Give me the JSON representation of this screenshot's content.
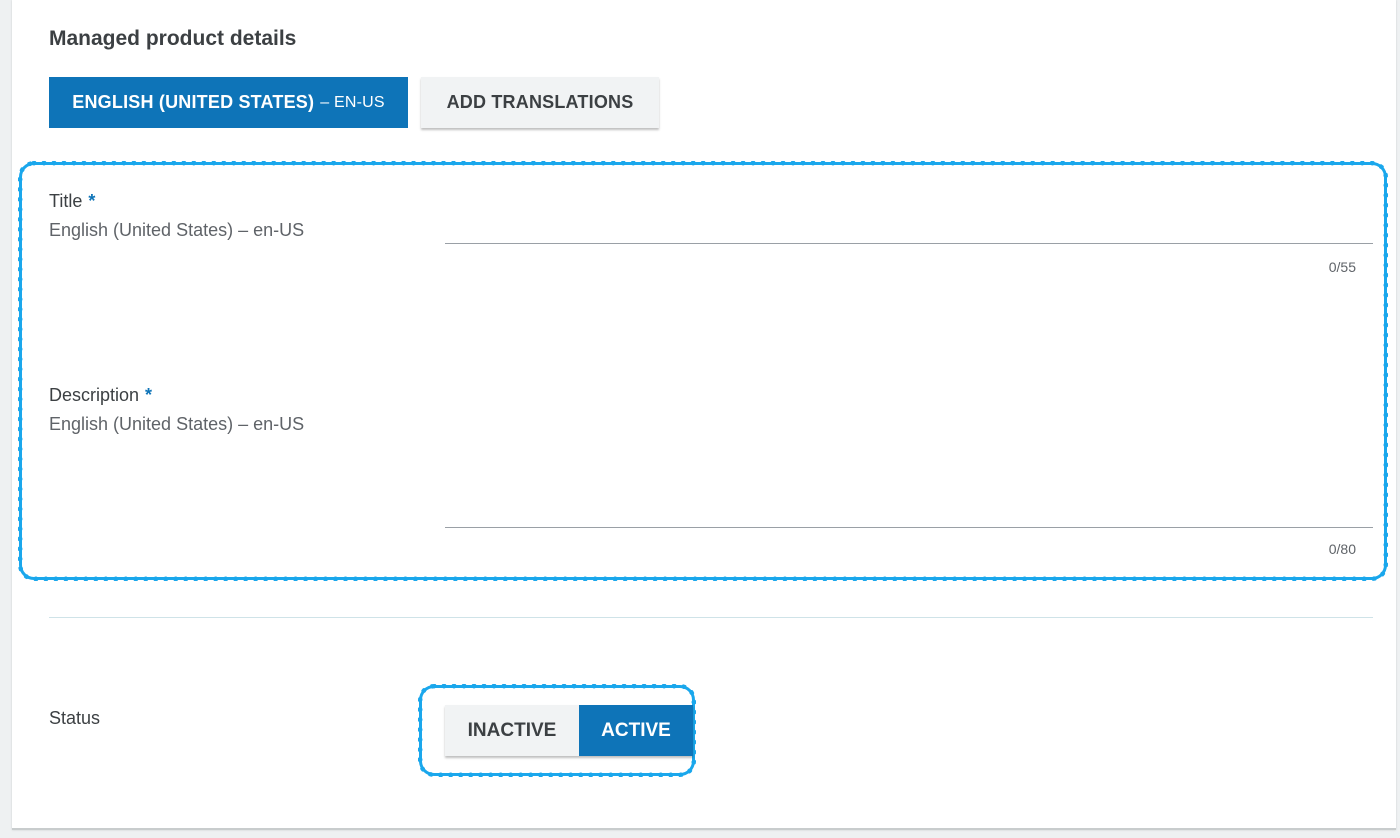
{
  "section": {
    "title": "Managed product details"
  },
  "language_tabs": {
    "current_label": "ENGLISH (UNITED STATES)",
    "current_code": "– EN-US",
    "add_label": "ADD TRANSLATIONS"
  },
  "fields": {
    "title": {
      "label": "Title",
      "required": "*",
      "locale": "English (United States) – en-US",
      "value": "",
      "counter": "0/55"
    },
    "description": {
      "label": "Description",
      "required": "*",
      "locale": "English (United States) – en-US",
      "value": "",
      "counter": "0/80"
    }
  },
  "status": {
    "label": "Status",
    "options": [
      "INACTIVE",
      "ACTIVE"
    ],
    "selected": "ACTIVE"
  },
  "colors": {
    "accent": "#0e74b8",
    "highlight": "#1aa7ec"
  }
}
